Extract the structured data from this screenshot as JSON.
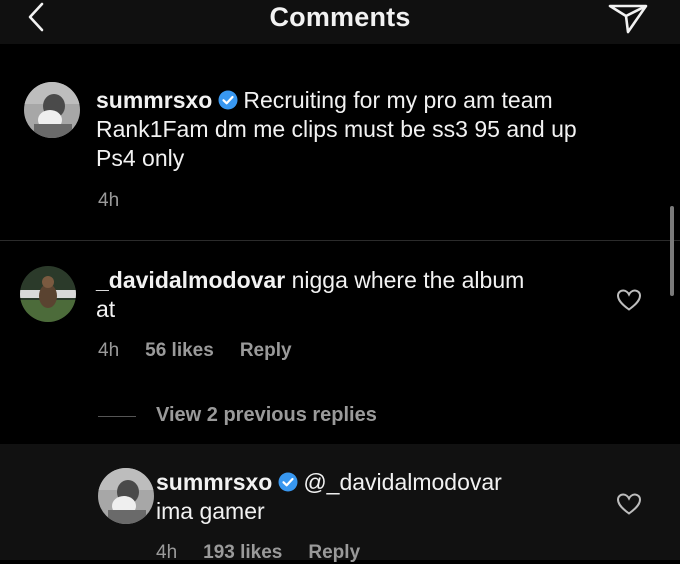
{
  "header": {
    "title": "Comments"
  },
  "caption": {
    "username": "summrsxo",
    "text_line1": "Recruiting for my pro am team",
    "text_line2": "Rank1Fam dm me clips must be ss3 95 and up",
    "text_line3": "Ps4 only",
    "time": "4h"
  },
  "comment": {
    "username": "_davidalmodovar",
    "text_line1": "nigga where the album",
    "text_line2": "at",
    "time": "4h",
    "likes": "56 likes",
    "reply_label": "Reply",
    "view_replies": "View 2 previous replies"
  },
  "reply": {
    "username": "summrsxo",
    "mention": "@_davidalmodovar",
    "text": "ima gamer",
    "time": "4h",
    "likes": "193 likes",
    "reply_label": "Reply"
  },
  "colors": {
    "background": "#000000",
    "header": "#101010",
    "secondary_text": "#9a9a9a",
    "verified": "#3897f0"
  }
}
